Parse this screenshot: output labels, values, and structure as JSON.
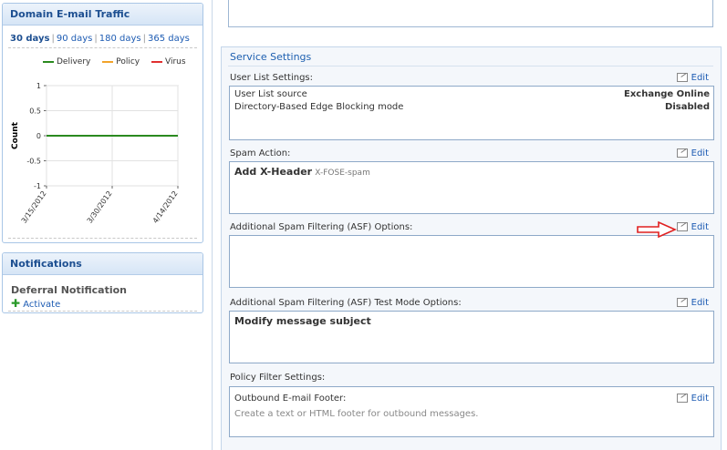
{
  "traffic": {
    "title": "Domain E-mail Traffic",
    "ranges": [
      "30 days",
      "90 days",
      "180 days",
      "365 days"
    ],
    "active_range": "30 days",
    "colors": {
      "delivery": "#2a8a1f",
      "policy": "#f2a32a",
      "virus": "#e03030",
      "accent": "#1d4f91"
    }
  },
  "chart_data": {
    "type": "line",
    "title": "",
    "xlabel": "",
    "ylabel": "Count",
    "x": [
      "3/15/2012",
      "3/30/2012",
      "4/14/2012"
    ],
    "ylim": [
      -1,
      1
    ],
    "yticks": [
      "1",
      "0.5",
      "0",
      "-0.5",
      "-1"
    ],
    "series": [
      {
        "name": "Delivery",
        "color": "#2a8a1f",
        "values": [
          0,
          0,
          0
        ]
      },
      {
        "name": "Policy",
        "color": "#f2a32a",
        "values": [
          0,
          0,
          0
        ]
      },
      {
        "name": "Virus",
        "color": "#e03030",
        "values": [
          0,
          0,
          0
        ]
      }
    ],
    "grid": true,
    "legend": "top"
  },
  "notifications": {
    "title": "Notifications",
    "item_label": "Deferral Notification",
    "action_label": "Activate"
  },
  "service": {
    "title": "Service Settings",
    "edit_label": "Edit",
    "user_list": {
      "label": "User List Settings:",
      "rows": [
        {
          "name": "User List source",
          "value": "Exchange Online"
        },
        {
          "name": "Directory-Based Edge Blocking mode",
          "value": "Disabled"
        }
      ]
    },
    "spam_action": {
      "label": "Spam Action:",
      "value": "Add X-Header",
      "detail": "X-FOSE-spam"
    },
    "asf": {
      "label": "Additional Spam Filtering (ASF) Options:"
    },
    "asf_test": {
      "label": "Additional Spam Filtering (ASF) Test Mode Options:",
      "value": "Modify message subject"
    },
    "policy_filter": {
      "label": "Policy Filter Settings:",
      "footer_label": "Outbound E-mail Footer:",
      "footer_hint": "Create a text or HTML footer for outbound messages."
    }
  }
}
